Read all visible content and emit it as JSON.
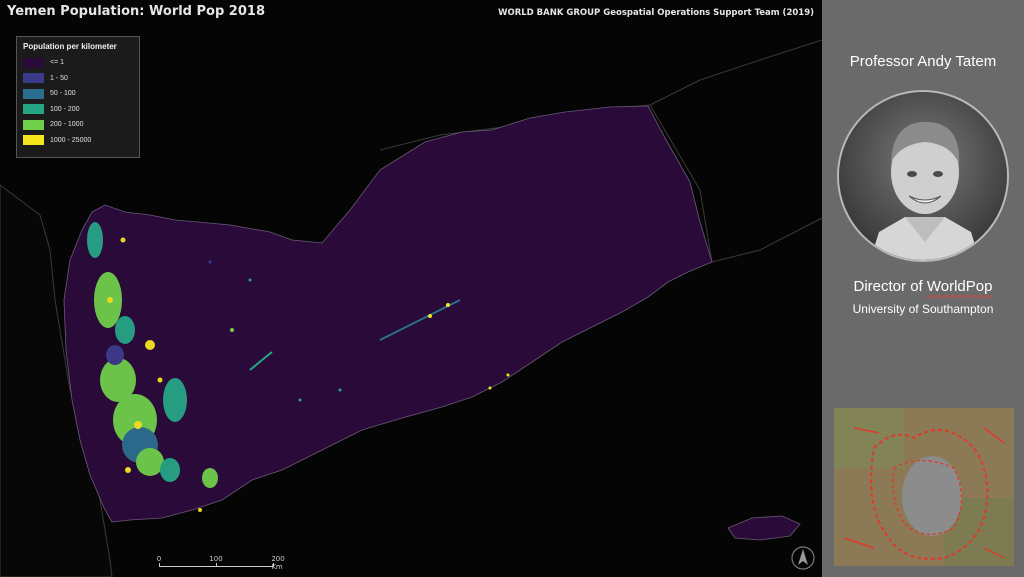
{
  "map": {
    "title": "Yemen Population: World Pop 2018",
    "credit": "WORLD BANK GROUP Geospatial Operations Support Team (2019)",
    "legend": {
      "title": "Population per kilometer",
      "items": [
        {
          "label": "<= 1",
          "color": "#2a0a38"
        },
        {
          "label": "1 - 50",
          "color": "#3b3b8c"
        },
        {
          "label": "50 - 100",
          "color": "#2c6e8e"
        },
        {
          "label": "100 - 200",
          "color": "#26a585"
        },
        {
          "label": "200 - 1000",
          "color": "#6fcf4a"
        },
        {
          "label": "1000 - 25000",
          "color": "#f5e51d"
        }
      ]
    },
    "scale": {
      "labels": [
        "0",
        "100",
        "200 Km"
      ]
    },
    "north_icon": "north-arrow-icon"
  },
  "panel": {
    "name": "Professor Andy Tatem",
    "role_prefix": "Director of ",
    "role_org": "WorldPop",
    "university": "University of Southampton",
    "background": "#6a6a6a"
  }
}
